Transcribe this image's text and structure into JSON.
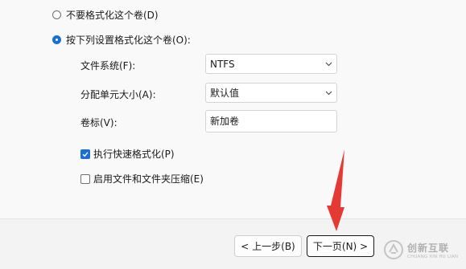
{
  "options": {
    "no_format": "不要格式化这个卷(D)",
    "format_with": "按下列设置格式化这个卷(O):"
  },
  "settings": {
    "filesystem_label": "文件系统(F):",
    "filesystem_value": "NTFS",
    "alloc_label": "分配单元大小(A):",
    "alloc_value": "默认值",
    "volume_label": "卷标(V):",
    "volume_value": "新加卷"
  },
  "checkboxes": {
    "quick_format": "执行快速格式化(P)",
    "compression": "启用文件和文件夹压缩(E)"
  },
  "buttons": {
    "back": "< 上一步(B)",
    "next": "下一页(N) >"
  },
  "watermark": {
    "name": "创新互联",
    "sub": "CHUANG XIN HU LIAN"
  },
  "colors": {
    "accent": "#1a6fd1",
    "annotation_arrow": "#e53935"
  }
}
